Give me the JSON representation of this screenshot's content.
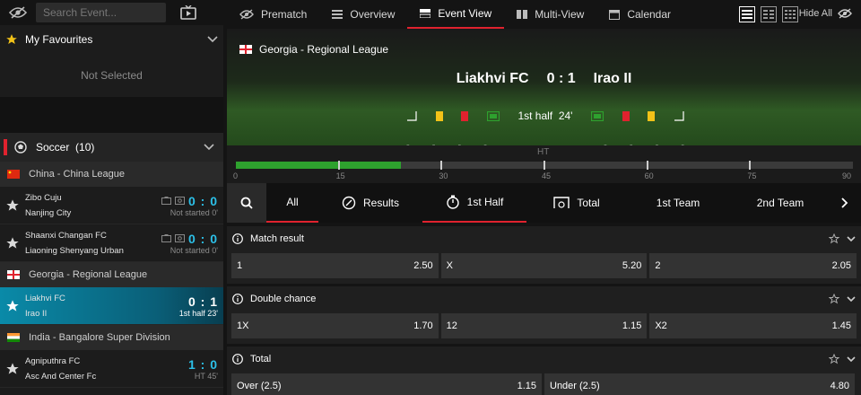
{
  "sidebar": {
    "search_placeholder": "Search Event...",
    "favourites_label": "My Favourites",
    "not_selected": "Not Selected",
    "sport_label": "Soccer",
    "sport_count": "(10)",
    "leagues": [
      {
        "name": "China - China League",
        "matches": [
          {
            "home": "Zibo Cuju",
            "away": "Nanjing City",
            "score": "0 : 0",
            "status": "Not started  0'"
          },
          {
            "home": "Shaanxi Changan FC",
            "away": "Liaoning Shenyang Urban",
            "score": "0 : 0",
            "status": "Not started  0'"
          }
        ]
      },
      {
        "name": "Georgia - Regional League",
        "matches": [
          {
            "home": "Liakhvi FC",
            "away": "Irao II",
            "score": "0 : 1",
            "status": "1st half  23'",
            "active": true
          }
        ]
      },
      {
        "name": "India - Bangalore Super Division",
        "matches": [
          {
            "home": "Agniputhra FC",
            "away": "Asc And Center Fc",
            "score": "1 : 0",
            "status": "HT  45'"
          }
        ]
      }
    ]
  },
  "topnav": {
    "tabs": [
      "Prematch",
      "Overview",
      "Event View",
      "Multi-View",
      "Calendar"
    ],
    "hide_all": "Hide All"
  },
  "event": {
    "league": "Georgia - Regional League",
    "home": "Liakhvi FC",
    "score": "0 : 1",
    "away": "Irao II",
    "period": "1st half",
    "minute": "24'",
    "stat_dash": "-"
  },
  "timeline": {
    "ht_label": "HT",
    "ticks": [
      "0",
      "15",
      "30",
      "45",
      "60",
      "75",
      "90"
    ],
    "elapsed_fraction": 0.267
  },
  "filters": [
    "All",
    "Results",
    "1st Half",
    "Total",
    "1st Team",
    "2nd Team"
  ],
  "markets": [
    {
      "title": "Match result",
      "odds": [
        {
          "label": "1",
          "value": "2.50"
        },
        {
          "label": "X",
          "value": "5.20"
        },
        {
          "label": "2",
          "value": "2.05"
        }
      ]
    },
    {
      "title": "Double chance",
      "odds": [
        {
          "label": "1X",
          "value": "1.70"
        },
        {
          "label": "12",
          "value": "1.15"
        },
        {
          "label": "X2",
          "value": "1.45"
        }
      ]
    },
    {
      "title": "Total",
      "odds": [
        {
          "label": "Over (2.5)",
          "value": "1.15"
        },
        {
          "label": "Under (2.5)",
          "value": "4.80"
        }
      ]
    }
  ],
  "colors": {
    "accent": "#e0222e",
    "score": "#2cc0e8",
    "active_row": "#0a8aa8",
    "progress": "#2ea12e"
  }
}
